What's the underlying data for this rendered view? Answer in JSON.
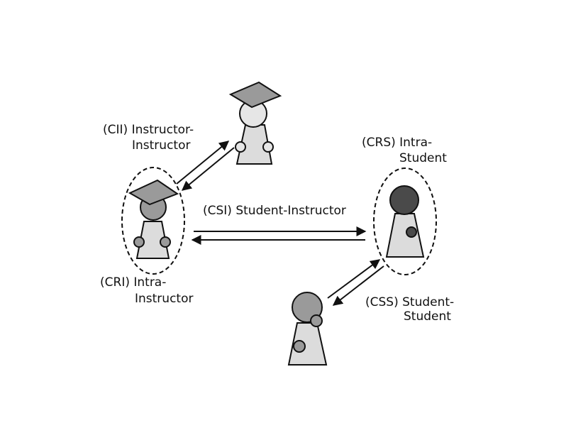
{
  "labels": {
    "cii_line1": "(CII) Instructor-",
    "cii_line2": "Instructor",
    "crs_line1": "(CRS) Intra-",
    "crs_line2": "Student",
    "csi": "(CSI) Student-Instructor",
    "cri_line1": "(CRI) Intra-",
    "cri_line2": "Instructor",
    "css_line1": "(CSS) Student-",
    "css_line2": "Student"
  },
  "colors": {
    "instructor_top_head": "#e6e6e6",
    "instructor_left_head": "#9a9a9a",
    "student_right_head": "#4a4a4a",
    "student_bottom_head": "#9a9a9a",
    "cap": "#9a9a9a",
    "body": "#dcdcdc"
  },
  "icons": [
    "graduation-cap-icon",
    "person-icon",
    "arrow-icon"
  ]
}
